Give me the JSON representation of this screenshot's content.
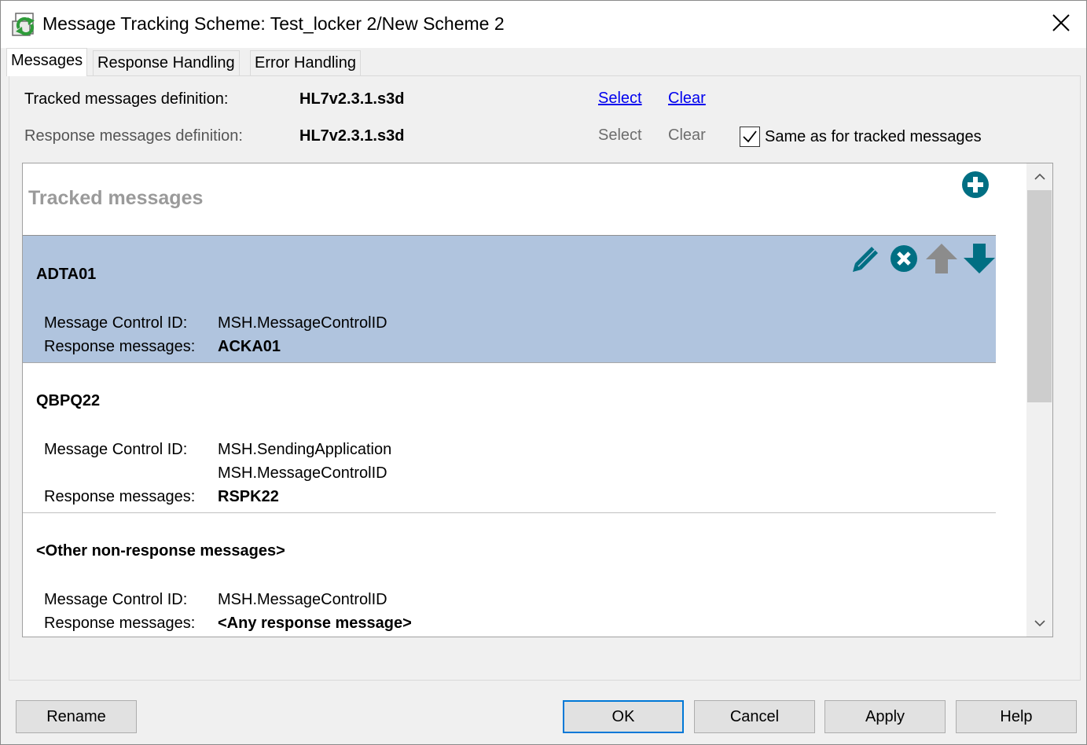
{
  "window": {
    "title": "Message Tracking Scheme: Test_locker 2/New Scheme 2",
    "icon": "message-tracking-app-icon",
    "close_icon": "close-icon"
  },
  "tabs": [
    {
      "label": "Messages",
      "active": true
    },
    {
      "label": "Response Handling",
      "active": false
    },
    {
      "label": "Error Handling",
      "active": false
    }
  ],
  "definitions": {
    "tracked": {
      "label": "Tracked messages definition:",
      "value": "HL7v2.3.1.s3d",
      "select_label": "Select",
      "clear_label": "Clear"
    },
    "response": {
      "label": "Response messages definition:",
      "value": "HL7v2.3.1.s3d",
      "select_label": "Select",
      "clear_label": "Clear",
      "same_as_label": "Same as for tracked messages",
      "same_as_checked": true
    }
  },
  "list": {
    "title": "Tracked messages",
    "control_id_label": "Message Control ID:",
    "response_label": "Response messages:",
    "entries": [
      {
        "name": "ADTA01",
        "control_ids": [
          "MSH.MessageControlID"
        ],
        "response": "ACKA01",
        "selected": true
      },
      {
        "name": "QBPQ22",
        "control_ids": [
          "MSH.SendingApplication",
          "MSH.MessageControlID"
        ],
        "response": "RSPK22",
        "selected": false
      },
      {
        "name": "<Other non-response messages>",
        "control_ids": [
          "MSH.MessageControlID"
        ],
        "response": "<Any response message>",
        "selected": false
      }
    ]
  },
  "buttons": {
    "rename": "Rename",
    "ok": "OK",
    "cancel": "Cancel",
    "apply": "Apply",
    "help": "Help"
  },
  "colors": {
    "accent_teal": "#006f83",
    "selected_row": "#b0c4de",
    "disabled_arrow": "#8c8c8c",
    "link": "#0000ee"
  }
}
